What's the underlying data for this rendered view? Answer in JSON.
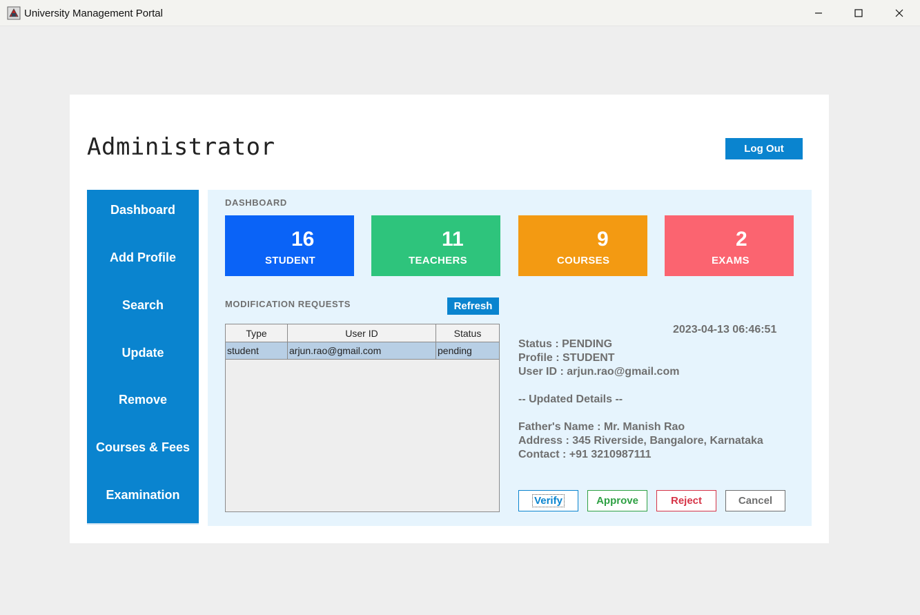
{
  "window": {
    "title": "University Management Portal"
  },
  "header": {
    "title": "Administrator",
    "logout_label": "Log Out"
  },
  "sidebar": {
    "items": [
      {
        "label": "Dashboard"
      },
      {
        "label": "Add Profile"
      },
      {
        "label": "Search"
      },
      {
        "label": "Update"
      },
      {
        "label": "Remove"
      },
      {
        "label": "Courses & Fees"
      },
      {
        "label": "Examination"
      }
    ]
  },
  "dashboard": {
    "label": "DASHBOARD",
    "stats": [
      {
        "value": "16",
        "label": "STUDENT",
        "color": "#0a63f7"
      },
      {
        "value": "11",
        "label": "TEACHERS",
        "color": "#2ec47c"
      },
      {
        "value": "9",
        "label": "COURSES",
        "color": "#f39a12"
      },
      {
        "value": "2",
        "label": "EXAMS",
        "color": "#fb6470"
      }
    ]
  },
  "requests": {
    "label": "MODIFICATION REQUESTS",
    "refresh_label": "Refresh",
    "columns": [
      "Type",
      "User ID",
      "Status"
    ],
    "rows": [
      {
        "type": "student",
        "user_id": "arjun.rao@gmail.com",
        "status": "pending"
      }
    ]
  },
  "detail": {
    "timestamp": "2023-04-13 06:46:51",
    "status": "Status : PENDING",
    "profile": "Profile : STUDENT",
    "user_id": "User ID : arjun.rao@gmail.com",
    "updated_header": "-- Updated Details --",
    "father": "Father's Name : Mr. Manish Rao",
    "address": "Address : 345 Riverside, Bangalore, Karnataka",
    "contact": "Contact : +91 3210987111"
  },
  "actions": {
    "verify": "Verify",
    "approve": "Approve",
    "reject": "Reject",
    "cancel": "Cancel"
  },
  "colors": {
    "accent": "#0a84cf",
    "verify": "#0a84cf",
    "approve": "#2ea043",
    "reject": "#d63447",
    "cancel": "#6f6f6f"
  }
}
